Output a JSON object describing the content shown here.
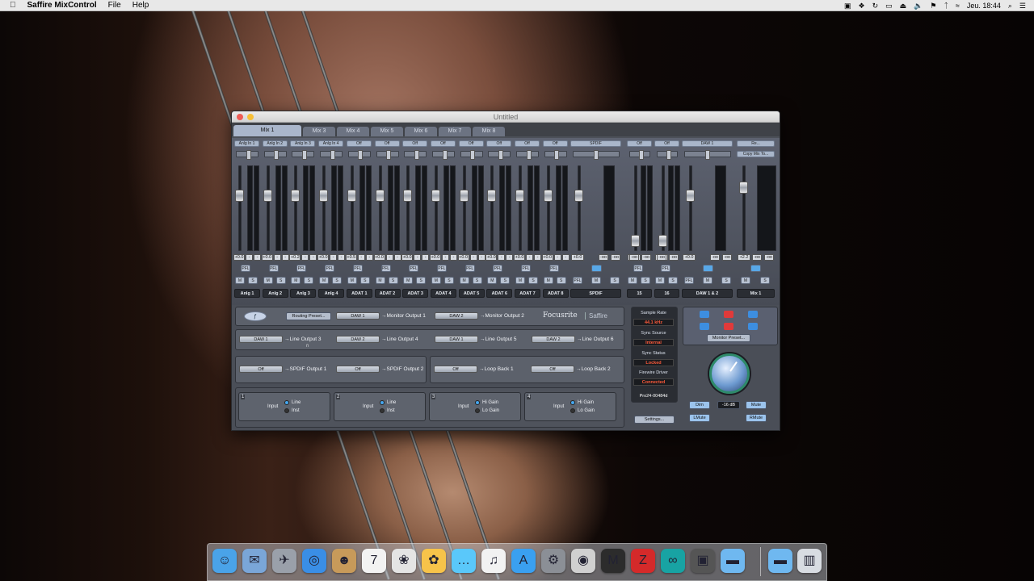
{
  "menubar": {
    "app": "Saffire MixControl",
    "menus": [
      "File",
      "Help"
    ],
    "clock": "Jeu. 18:44"
  },
  "window": {
    "title": "Untitled"
  },
  "tabs": [
    "Mix 1",
    "Mix 3",
    "Mix 4",
    "Mix 5",
    "Mix 6",
    "Mix 7",
    "Mix 8"
  ],
  "strips": [
    {
      "sel": "Anlg In 1",
      "val": "+0.0",
      "name": "Anlg 1"
    },
    {
      "sel": "Anlg In 2",
      "val": "+0.0",
      "name": "Anlg 2"
    },
    {
      "sel": "Anlg In 3",
      "val": "+0.2",
      "name": "Anlg 3"
    },
    {
      "sel": "Anlg In 4",
      "val": "+0.0",
      "name": "Anlg 4"
    },
    {
      "sel": "Off",
      "val": "+0.5",
      "name": "ADAT 1"
    },
    {
      "sel": "Off",
      "val": "+0.0",
      "name": "ADAT 2"
    },
    {
      "sel": "Off",
      "val": "+0.0",
      "name": "ADAT 3"
    },
    {
      "sel": "Off",
      "val": "+0.0",
      "name": "ADAT 4"
    },
    {
      "sel": "Off",
      "val": "+0.0",
      "name": "ADAT 5"
    },
    {
      "sel": "Off",
      "val": "+0.0",
      "name": "ADAT 6"
    },
    {
      "sel": "Off",
      "val": "+0.0",
      "name": "ADAT 7"
    },
    {
      "sel": "Off",
      "val": "+0.0",
      "name": "ADAT 8"
    }
  ],
  "stereo": [
    {
      "sel": "SPDIF",
      "val": "+0.0",
      "name": "SPDIF"
    },
    {
      "sel": "Off",
      "val": "-85.0",
      "name": "15"
    },
    {
      "sel": "Off",
      "val": "+0.0",
      "name": "16"
    },
    {
      "sel": "DAW 1",
      "val": "+0.0",
      "name": "DAW 1 & 2"
    },
    {
      "sel": "Re...",
      "val": "+2.2",
      "name": "Mix 1"
    }
  ],
  "neg_inf": "-oo",
  "buttons": {
    "pfl": "PFL",
    "mute": "M",
    "solo": "S",
    "copy": "Copy Mix To...",
    "routing": "Routing Preset...",
    "settings": "Settings...",
    "monitor": "Monitor Preset...",
    "dim": "Dim",
    "mute_btn": "Mute",
    "lmute": "LMute",
    "rmute": "RMute",
    "level": "-16 dB"
  },
  "routes_main": [
    {
      "src": "DAW 1",
      "dst": "Monitor Output 1"
    },
    {
      "src": "DAW 2",
      "dst": "Monitor Output 2"
    }
  ],
  "brand": {
    "name": "Focusrite",
    "product": "Saffire"
  },
  "routes_line": [
    {
      "src": "DAW 1",
      "dst": "Line Output 3"
    },
    {
      "src": "DAW 2",
      "dst": "Line Output 4"
    },
    {
      "src": "DAW 1",
      "dst": "Line Output 5"
    },
    {
      "src": "DAW 2",
      "dst": "Line Output 6"
    }
  ],
  "routes_spdif": [
    {
      "src": "Off",
      "dst": "SPDIF Output 1"
    },
    {
      "src": "Off",
      "dst": "SPDIF Output 2"
    },
    {
      "src": "Off",
      "dst": "Loop Back 1"
    },
    {
      "src": "Off",
      "dst": "Loop Back 2"
    }
  ],
  "inputs": [
    {
      "num": "1",
      "label": "Input",
      "a": "Line",
      "b": "Inst"
    },
    {
      "num": "2",
      "label": "Input",
      "a": "Line",
      "b": "Inst"
    },
    {
      "num": "3",
      "label": "Input",
      "a": "Hi Gain",
      "b": "Lo Gain"
    },
    {
      "num": "4",
      "label": "Input",
      "a": "Hi Gain",
      "b": "Lo Gain"
    }
  ],
  "status": {
    "sample_rate_label": "Sample Rate",
    "sample_rate": "44.1 kHz",
    "sync_source_label": "Sync Source",
    "sync_source": "Internal",
    "sync_status_label": "Sync Status",
    "sync_status": "Locked",
    "fw_label": "Firewire Driver",
    "fw": "Connected",
    "device": "Pro24-00484d"
  },
  "colors": {
    "accent": "#58a8e8",
    "status": "#ff5a3a"
  }
}
